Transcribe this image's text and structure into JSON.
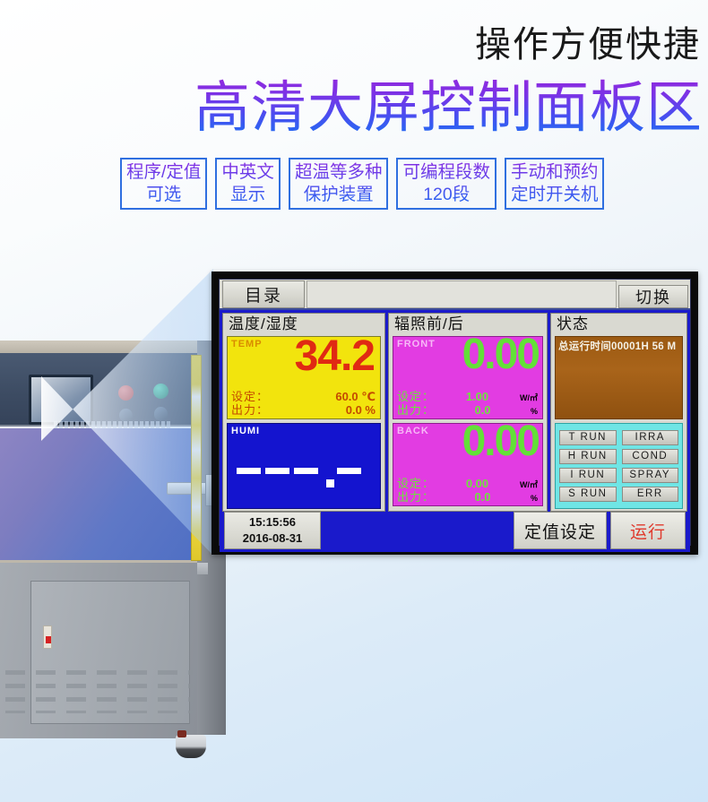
{
  "hero": {
    "subtitle": "操作方便快捷",
    "title": "高清大屏控制面板区"
  },
  "features": [
    {
      "name": "program-setpoint",
      "text": "程序/定值\n可选"
    },
    {
      "name": "bilingual-display",
      "text": "中英文\n显示"
    },
    {
      "name": "over-temp-protection",
      "text": "超温等多种\n保护装置"
    },
    {
      "name": "programmable-segments",
      "text": "可编程段数\n120段"
    },
    {
      "name": "manual-and-scheduled",
      "text": "手动和预约\n定时开关机"
    }
  ],
  "hmi": {
    "top": {
      "menu_label": "目录",
      "switch_label": "切换"
    },
    "temp_humi": {
      "title": "温度/湿度",
      "temp": {
        "tag": "TEMP",
        "value": "34.2",
        "set_label": "设定：",
        "set_value": "60.0 ℃",
        "out_label": "出力：",
        "out_value": "0.0 %"
      },
      "humi": {
        "tag": "HUMI",
        "value": "---.--"
      }
    },
    "irradiance": {
      "title": "辐照前/后",
      "front": {
        "tag": "FRONT",
        "value": "0.00",
        "set_label": "设定：",
        "set_value": "1.00",
        "set_unit": "W/㎡",
        "out_label": "出力：",
        "out_value": "0.0",
        "out_unit": "%"
      },
      "back": {
        "tag": "BACK",
        "value": "0.00",
        "set_label": "设定：",
        "set_value": "0.00",
        "set_unit": "W/㎡",
        "out_label": "出力：",
        "out_value": "0.0",
        "out_unit": "%"
      }
    },
    "status": {
      "title": "状态",
      "runtime_text": "总运行时间00001H 56 M",
      "indicators": [
        "T RUN",
        "IRRA",
        "H RUN",
        "COND",
        "I RUN",
        "SPRAY",
        "S RUN",
        "ERR"
      ]
    },
    "bottom": {
      "time": "15:15:56",
      "date": "2016-08-31",
      "setpoint_button": "定值设定",
      "run_button": "运行"
    }
  },
  "colors": {
    "accent_blue": "#1f6ef2",
    "accent_purple": "#8a2be2",
    "temp_bg": "#f2e40d",
    "temp_value": "#e02a13",
    "humi_bg": "#1414cf",
    "irradiance_bg": "#e23ce2",
    "irradiance_value": "#63e038",
    "status_bg": "#a9641a",
    "led_panel_bg": "#6fe5e5",
    "screen_bg": "#1a1acb"
  }
}
